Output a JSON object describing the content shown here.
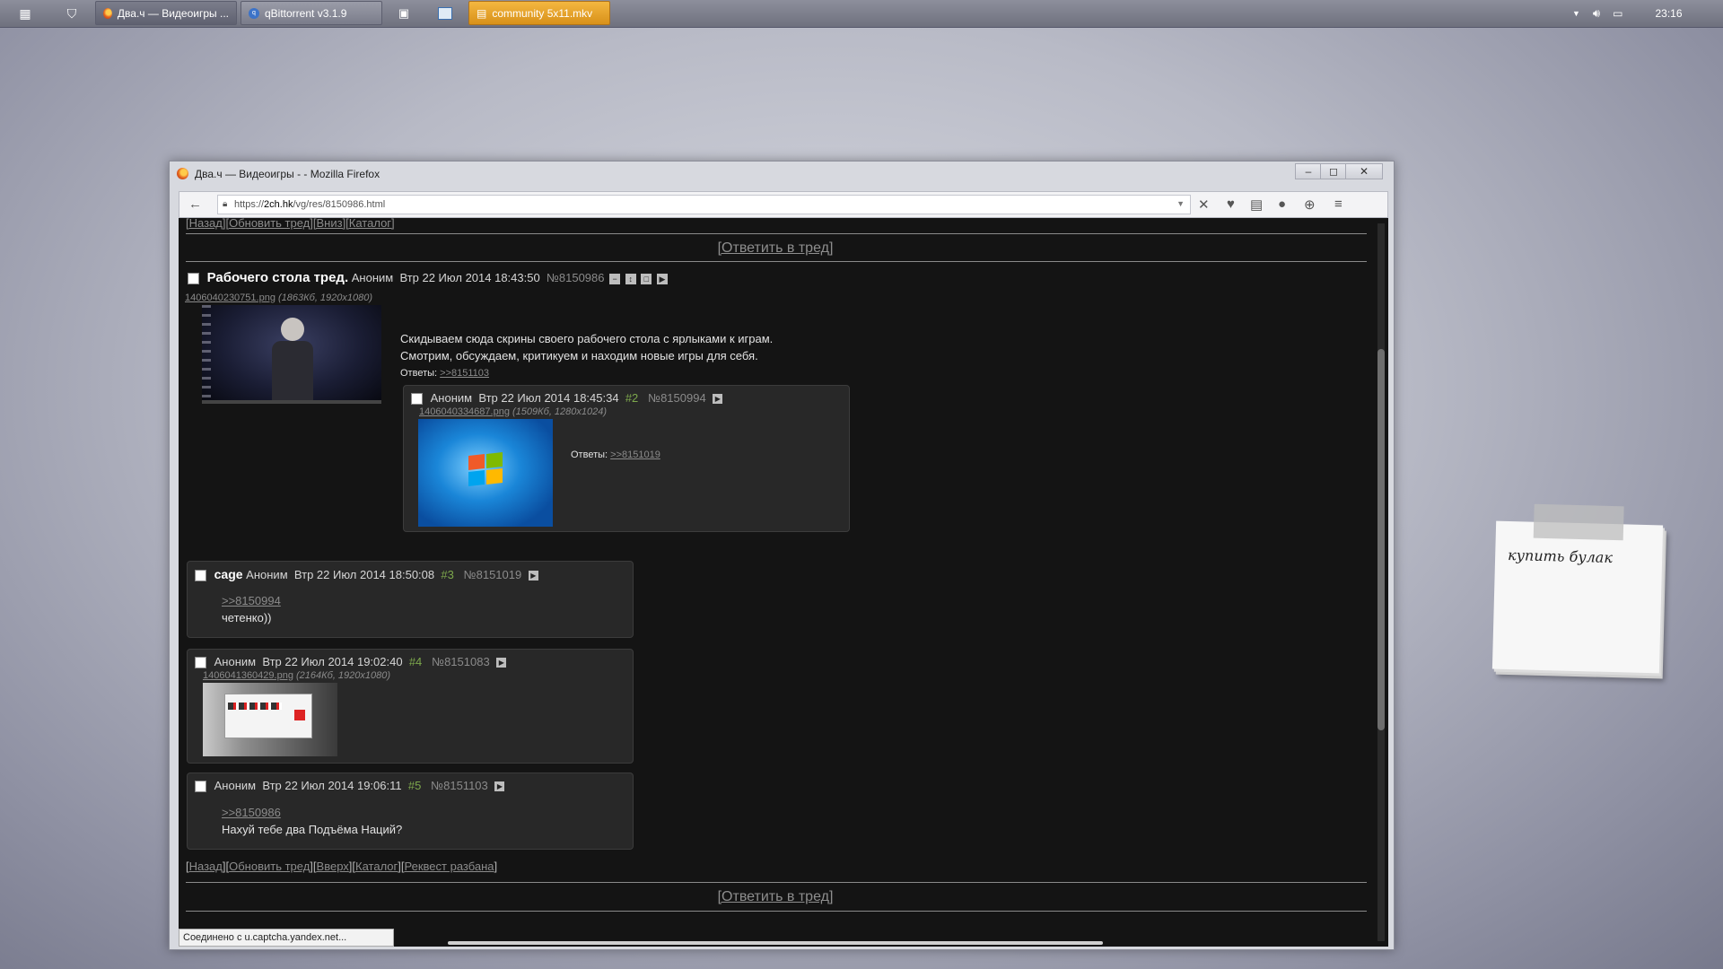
{
  "taskbar": {
    "tasks": [
      {
        "label": "Два.ч — Видеоигры ...",
        "icon": "firefox-icon"
      },
      {
        "label": "qBittorrent v3.1.9",
        "icon": "qbittorrent-icon"
      },
      {
        "label": "community 5x11.mkv",
        "icon": "video-player-icon"
      }
    ],
    "clock": "23:16"
  },
  "window": {
    "title": "Два.ч — Видеоигры - - Mozilla Firefox",
    "url_prefix": "https://",
    "url_domain": "2ch.hk",
    "url_path": "/vg/res/8150986.html"
  },
  "page": {
    "top_nav": "[Назад][Обновить тред][Вниз][Каталог]",
    "reply_link": "[Ответить в тред]",
    "bottom_nav": {
      "open": "[",
      "items": [
        "Назад",
        "Обновить тред",
        "Вверх",
        "Каталог",
        "Реквест разбана"
      ],
      "sep": "][",
      "close": "]"
    },
    "op": {
      "subject": "Рабочего стола тред.",
      "author": "Аноним",
      "date": "Втр 22 Июл 2014 18:43:50",
      "number": "№8150986",
      "file_name": "1406040230751.png",
      "file_meta": "(1863Кб, 1920x1080)",
      "text_line1": "Скидываем сюда скрины своего рабочего стола с ярлыками к играм.",
      "text_line2": "Смотрим, обсуждаем, критикуем и находим новые игры для себя.",
      "replies_label": "Ответы:",
      "replies": ">>8151103"
    },
    "posts": [
      {
        "author": "Аноним",
        "date": "Втр 22 Июл 2014 18:45:34",
        "ord": "#2",
        "number": "№8150994",
        "file_name": "1406040334687.png",
        "file_meta": "(1509Кб, 1280x1024)",
        "replies_label": "Ответы:",
        "replies": ">>8151019"
      },
      {
        "sage": "сage",
        "author": "Аноним",
        "date": "Втр 22 Июл 2014 18:50:08",
        "ord": "#3",
        "number": "№8151019",
        "quote": ">>8150994",
        "text": "четенко))"
      },
      {
        "author": "Аноним",
        "date": "Втр 22 Июл 2014 19:02:40",
        "ord": "#4",
        "number": "№8151083",
        "file_name": "1406041360429.png",
        "file_meta": "(2164Кб, 1920x1080)"
      },
      {
        "author": "Аноним",
        "date": "Втр 22 Июл 2014 19:06:11",
        "ord": "#5",
        "number": "№8151103",
        "quote": ">>8150986",
        "text": "Нахуй тебе два Подъёма Наций?"
      }
    ]
  },
  "status_text": "Соединено с u.captcha.yandex.net...",
  "sticky_note": "купить булак",
  "colors": {
    "accent_green": "#7da84c",
    "page_bg": "#141414",
    "post_bg": "#282828"
  }
}
